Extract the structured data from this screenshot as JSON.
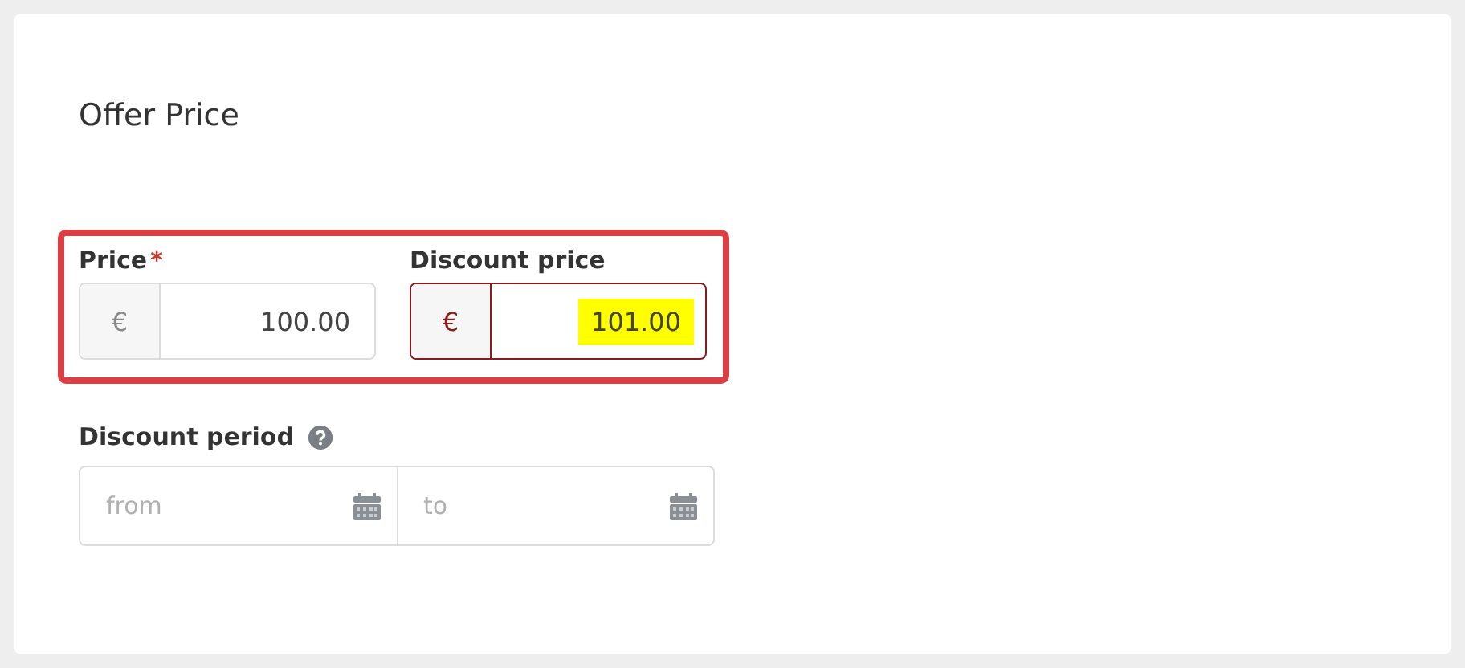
{
  "card": {
    "title": "Offer Price"
  },
  "price_group": {
    "outlined": true,
    "fields": [
      {
        "label": "Price",
        "required_mark": "*",
        "currency": "€",
        "value": "100.00",
        "invalid": false,
        "highlighted": false
      },
      {
        "label": "Discount price",
        "currency": "€",
        "value": "101.00",
        "invalid": true,
        "highlighted": true
      }
    ]
  },
  "discount_period": {
    "label": "Discount period",
    "help": true,
    "from": {
      "placeholder": "from"
    },
    "to": {
      "placeholder": "to"
    }
  }
}
